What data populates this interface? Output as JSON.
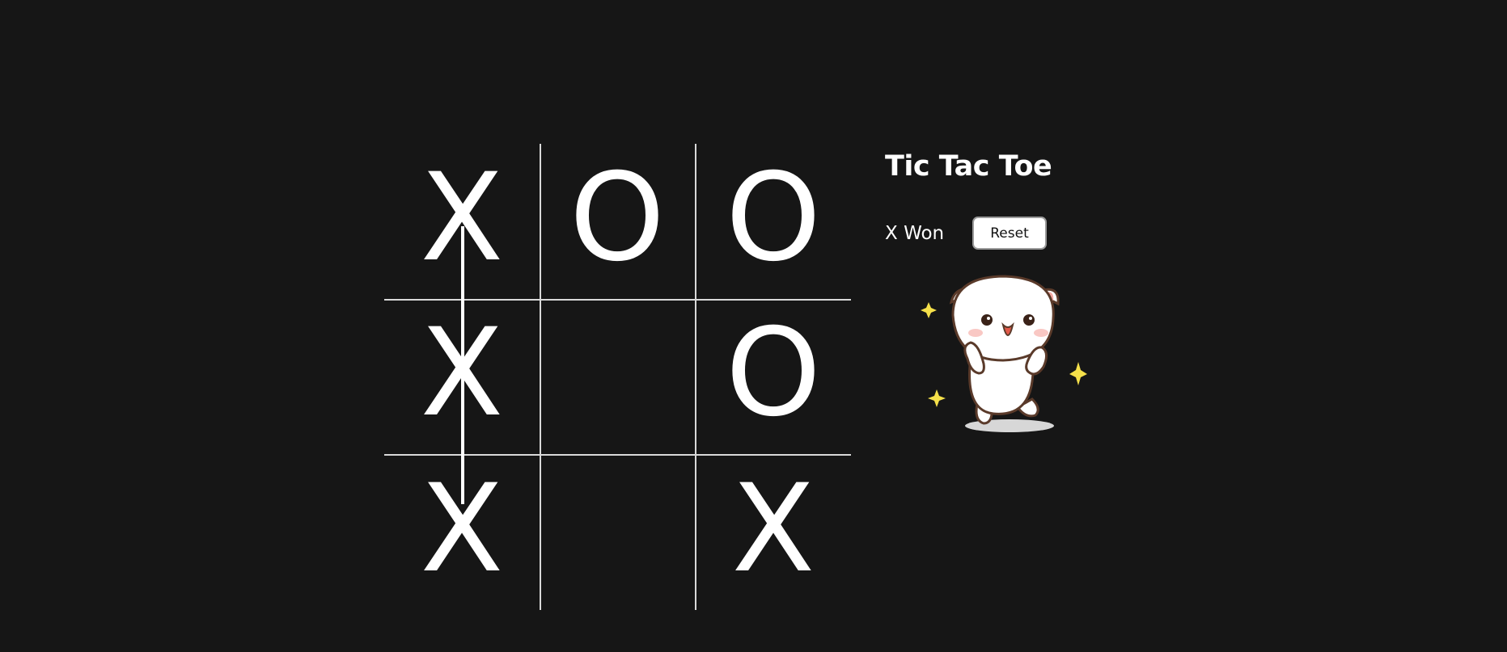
{
  "game": {
    "title": "Tic Tac Toe",
    "status": "X Won",
    "reset_label": "Reset",
    "board": [
      "X",
      "O",
      "O",
      "X",
      "",
      "O",
      "X",
      "",
      "X"
    ],
    "winning_line": "left-column"
  },
  "colors": {
    "background": "#161616",
    "foreground": "#ffffff",
    "grid": "#d9d9d9",
    "button_bg": "#ffffff",
    "sparkle": "#f5e04a"
  },
  "icons": {
    "mascot": "celebrating-cat-icon",
    "sparkle": "sparkle-icon"
  }
}
